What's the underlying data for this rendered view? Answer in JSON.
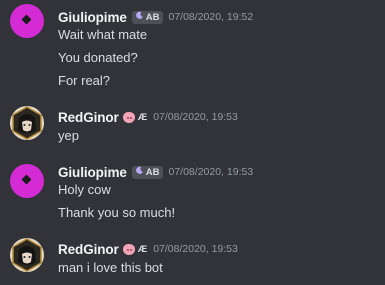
{
  "messages": [
    {
      "username": "Giuliopime",
      "badge": "AB",
      "timestamp": "07/08/2020, 19:52",
      "avatar_color": "#d52bd5",
      "lines": [
        "Wait what mate",
        "You donated?",
        "For real?"
      ]
    },
    {
      "username": "RedGinor",
      "badge": "Æ",
      "timestamp": "07/08/2020, 19:53",
      "lines": [
        "yep"
      ]
    },
    {
      "username": "Giuliopime",
      "badge": "AB",
      "timestamp": "07/08/2020, 19:53",
      "avatar_color": "#d52bd5",
      "lines": [
        "Holy cow",
        "Thank you so much!"
      ]
    },
    {
      "username": "RedGinor",
      "badge": "Æ",
      "timestamp": "07/08/2020, 19:53",
      "lines": [
        "man i love this bot"
      ]
    }
  ],
  "colors": {
    "background": "#313338",
    "username": "#f2f3f5",
    "text": "#dbdee1",
    "timestamp": "#949ba4"
  }
}
